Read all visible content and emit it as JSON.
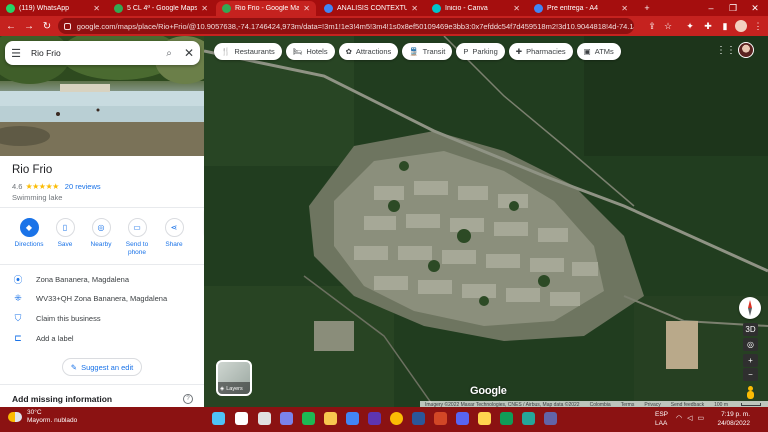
{
  "browser": {
    "tabs": [
      {
        "label": "(119) WhatsApp",
        "active": false,
        "favicon_color": "#25d366"
      },
      {
        "label": "5 CL 4ª - Google Maps",
        "active": false,
        "favicon_color": "#34a853"
      },
      {
        "label": "Rio Frio - Google Maps",
        "active": true,
        "favicon_color": "#34a853"
      },
      {
        "label": "ANALISIS CONTEXTUAL RIO",
        "active": false,
        "favicon_color": "#4285f4"
      },
      {
        "label": "Inicio - Canva",
        "active": false,
        "favicon_color": "#00c4cc"
      },
      {
        "label": "Pre entrega - A4",
        "active": false,
        "favicon_color": "#4285f4"
      }
    ],
    "new_tab_glyph": "+",
    "url": "google.com/maps/place/Rio+Frio/@10.9057638,-74.1746424,973m/data=!3m1!1e3!4m5!3m4!1s0x8ef50109469e3bb3:0x7efddc54f7d459518m2!3d10.9044818!4d-74.1461026"
  },
  "sidebar": {
    "search_value": "Rio Frio",
    "place_name": "Rio Frio",
    "rating": "4.6",
    "stars": "★★★★★",
    "reviews": "20 reviews",
    "category": "Swimming lake",
    "actions": [
      {
        "label": "Directions",
        "icon": "directions-icon",
        "glyph": "◆"
      },
      {
        "label": "Save",
        "icon": "bookmark-icon",
        "glyph": "▯"
      },
      {
        "label": "Nearby",
        "icon": "nearby-icon",
        "glyph": "◎"
      },
      {
        "label": "Send to\nphone",
        "icon": "send-to-phone-icon",
        "glyph": "▭"
      },
      {
        "label": "Share",
        "icon": "share-icon",
        "glyph": "⋖"
      }
    ],
    "info": [
      {
        "icon": "location-pin-icon",
        "glyph": "⦿",
        "text": "Zona Bananera, Magdalena"
      },
      {
        "icon": "plus-code-icon",
        "glyph": "⁜",
        "text": "WV33+QH Zona Bananera, Magdalena"
      },
      {
        "icon": "shield-check-icon",
        "glyph": "⛉",
        "text": "Claim this business"
      },
      {
        "icon": "label-icon",
        "glyph": "⊏",
        "text": "Add a label"
      }
    ],
    "suggest_edit": "Suggest an edit",
    "missing_title": "Add missing information"
  },
  "map": {
    "chips": [
      {
        "label": "Restaurants",
        "glyph": "🍴"
      },
      {
        "label": "Hotels",
        "glyph": "🛏"
      },
      {
        "label": "Attractions",
        "glyph": "✿"
      },
      {
        "label": "Transit",
        "glyph": "🚆"
      },
      {
        "label": "Parking",
        "glyph": "P"
      },
      {
        "label": "Pharmacies",
        "glyph": "✚"
      },
      {
        "label": "ATMs",
        "glyph": "▣"
      }
    ],
    "layers_label": "Layers",
    "logo": "Google",
    "attribution": [
      "Imagery ©2022 Maxar Technologies, CNES / Airbus, Map data ©2022",
      "Colombia",
      "Terms",
      "Privacy",
      "Send feedback",
      "100 m"
    ],
    "controls": {
      "threed": "3D",
      "zoom_in": "+",
      "zoom_out": "−"
    }
  },
  "taskbar": {
    "weather_temp": "30°C",
    "weather_desc": "Mayorm. nublado",
    "lang": "ESP",
    "lang2": "LAA",
    "time": "7:19 p. m.",
    "date": "24/08/2022"
  }
}
